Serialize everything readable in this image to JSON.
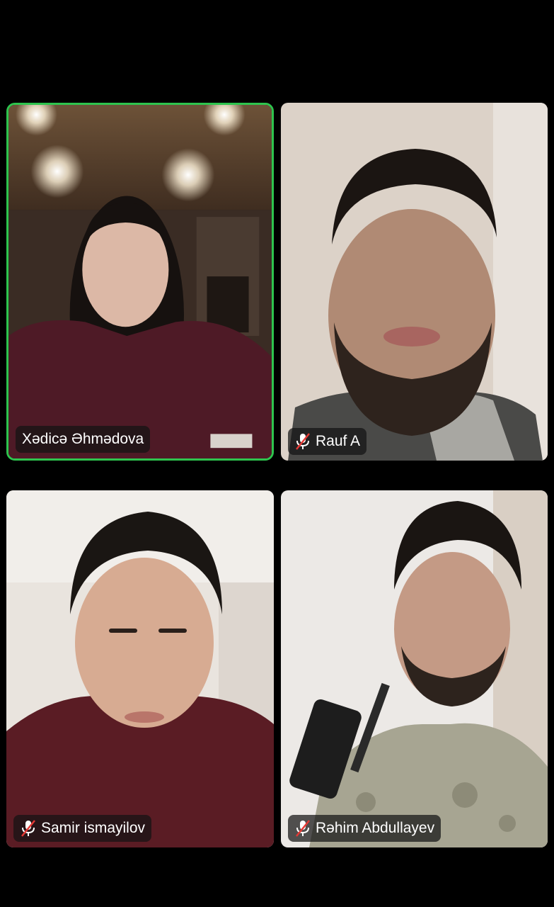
{
  "participants": [
    {
      "name": "Xədicə Əhmədova",
      "muted": false,
      "active_speaker": true
    },
    {
      "name": "Rauf A",
      "muted": true,
      "active_speaker": false
    },
    {
      "name": "Samir ismayilov",
      "muted": true,
      "active_speaker": false
    },
    {
      "name": "Rəhim Abdullayev",
      "muted": true,
      "active_speaker": false
    }
  ],
  "colors": {
    "background": "#000000",
    "active_border": "#2ec44e",
    "mute_slash": "#e53935",
    "badge_bg": "rgba(20,20,20,0.72)"
  }
}
